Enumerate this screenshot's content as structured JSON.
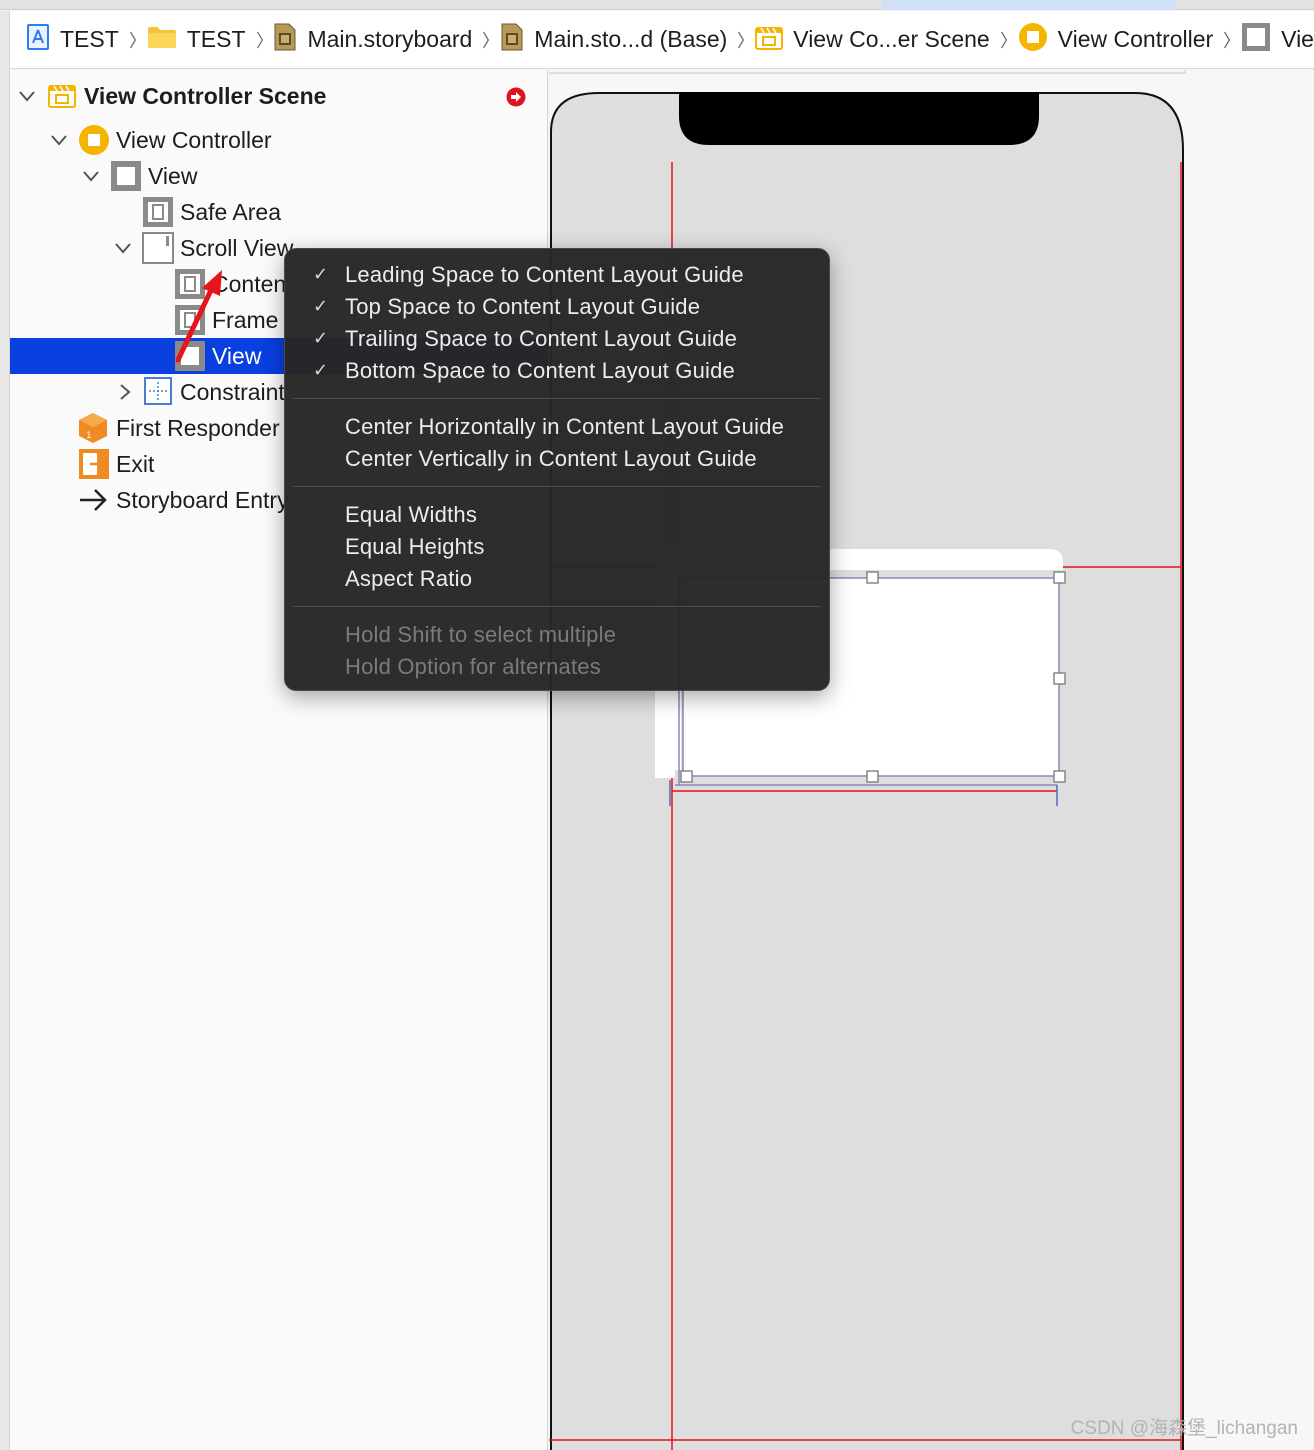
{
  "breadcrumb": [
    {
      "label": "TEST",
      "icon": "app-project-icon"
    },
    {
      "label": "TEST",
      "icon": "folder-icon"
    },
    {
      "label": "Main.storyboard",
      "icon": "storyboard-file-icon"
    },
    {
      "label": "Main.sto...d (Base)",
      "icon": "storyboard-file-icon"
    },
    {
      "label": "View Co...er Scene",
      "icon": "scene-icon"
    },
    {
      "label": "View Controller",
      "icon": "view-controller-icon"
    },
    {
      "label": "Vie",
      "icon": "view-icon"
    }
  ],
  "outline": {
    "scene": "View Controller Scene",
    "view_controller": "View Controller",
    "view": "View",
    "safe_area": "Safe Area",
    "scroll_view": "Scroll View",
    "content_layout": "Conten",
    "frame_layout": "Frame",
    "selected_view": "View",
    "constraints": "Constraint",
    "first_responder": "First Responder",
    "exit": "Exit",
    "storyboard_entry": "Storyboard Entry"
  },
  "context_menu": {
    "group1": [
      {
        "label": "Leading Space to Content Layout Guide",
        "checked": true
      },
      {
        "label": "Top Space to Content Layout Guide",
        "checked": true
      },
      {
        "label": "Trailing Space to Content Layout Guide",
        "checked": true
      },
      {
        "label": "Bottom Space to Content Layout Guide",
        "checked": true
      }
    ],
    "group2": [
      {
        "label": "Center Horizontally in Content Layout Guide"
      },
      {
        "label": "Center Vertically in Content Layout Guide"
      }
    ],
    "group3": [
      {
        "label": "Equal Widths"
      },
      {
        "label": "Equal Heights"
      },
      {
        "label": "Aspect Ratio"
      }
    ],
    "hints": [
      {
        "label": "Hold Shift to select multiple"
      },
      {
        "label": "Hold Option for alternates"
      }
    ]
  },
  "check_mark": "✓",
  "watermark": "CSDN @海森堡_lichangan",
  "colors": {
    "selection": "#0a3fe0",
    "menu_bg": "#262626",
    "constraint_red": "#e0141e",
    "scene_yellow": "#f5b400",
    "arrow_red": "#e8141c"
  }
}
